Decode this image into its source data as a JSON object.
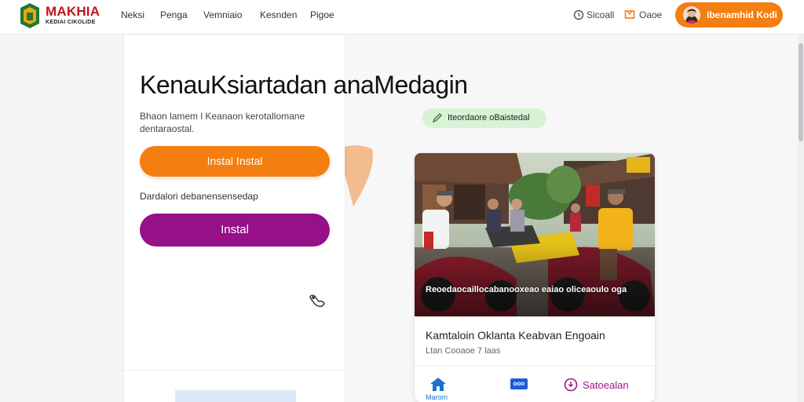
{
  "header": {
    "logo": {
      "title": "MAKHIA",
      "subtitle": "KEDIAI CIKOLIDE"
    },
    "nav": [
      "Neksi",
      "Penga",
      "Vemniaio",
      "Kesnden",
      "Pigoe"
    ],
    "right_links": [
      {
        "icon": "clock-icon",
        "label": "Sicoall"
      },
      {
        "icon": "cart-icon",
        "label": "Oaoe"
      }
    ],
    "profile_button": "Ibenamhid Kodi"
  },
  "hero": {
    "title": "KenauKsiartadan  anaMedagin",
    "description": "Bhaon lamem l Keanaon kerotallomane dentaraostal.",
    "primary_button": "Instal Instal",
    "secondary_label": "Dardalori debanensensedap",
    "secondary_button": "Instal"
  },
  "tag": {
    "icon": "pen-icon",
    "label": "Iteordaore oBaistedal"
  },
  "media_card": {
    "caption": "Reoedaocaillocabanooxeao eaiao oliceaoulo oga",
    "title": "Kamtaloin Oklanta Keabvan Engoain",
    "meta": "Ltan Cooaoe 7 laas",
    "tabs": {
      "home_label": "Marom",
      "badge_text": "ooo",
      "save_label": "Satoealan"
    }
  },
  "colors": {
    "accent_orange": "#f47e10",
    "accent_purple": "#961088",
    "tag_green": "#d9f2d6",
    "link_blue": "#1a73c8"
  }
}
